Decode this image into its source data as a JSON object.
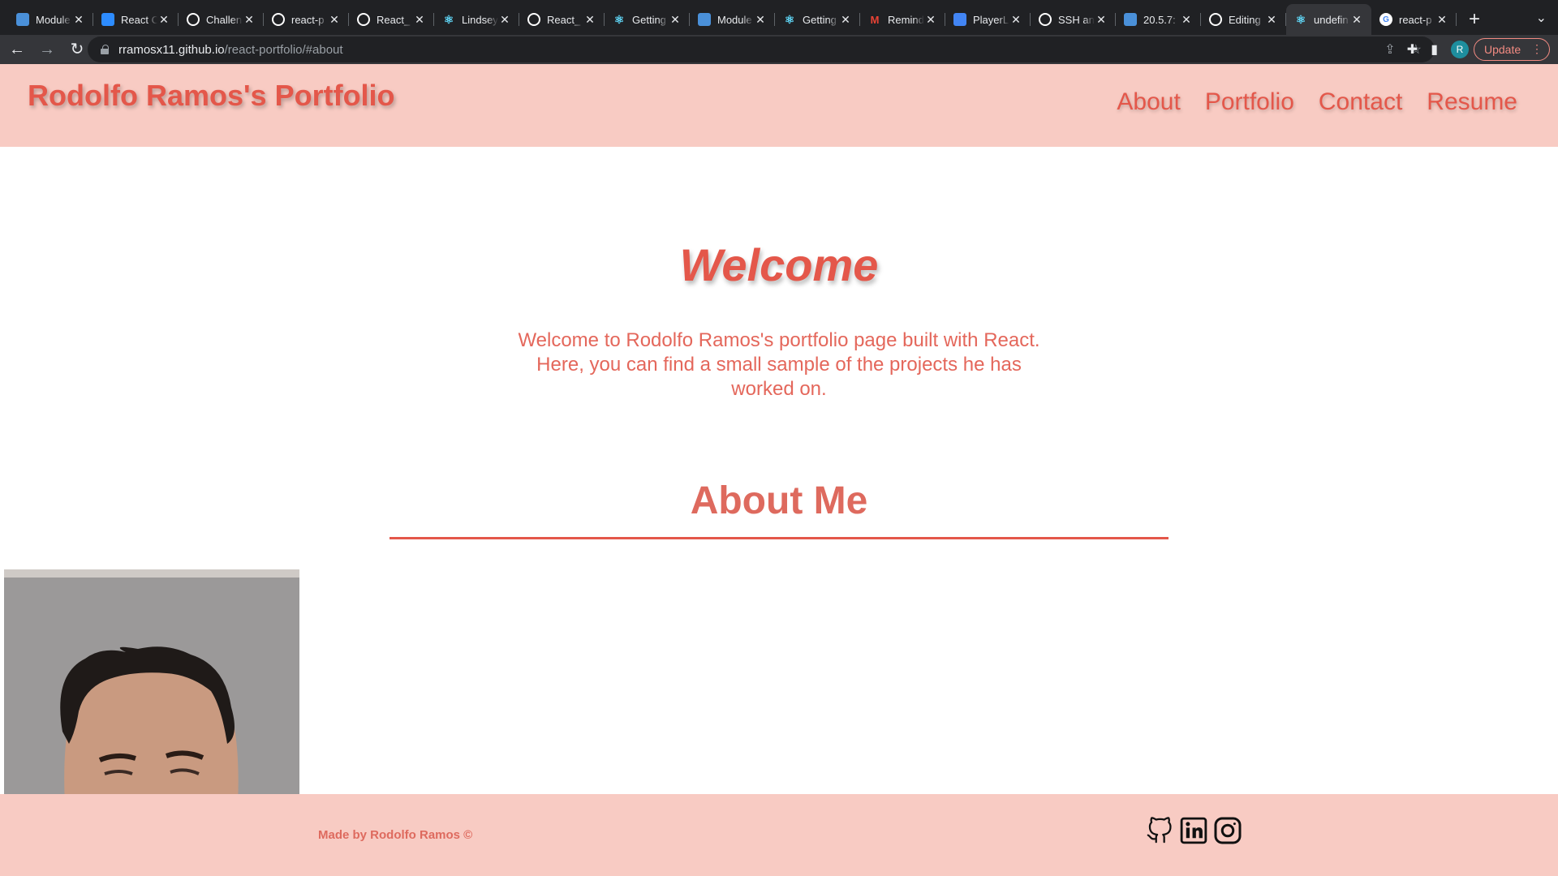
{
  "browser": {
    "tabs": [
      {
        "title": "Module",
        "favicon": "doc-icon",
        "color": "#4a90d9"
      },
      {
        "title": "React C",
        "favicon": "zoom-icon",
        "color": "#2d8cff"
      },
      {
        "title": "Challen",
        "favicon": "github-icon",
        "color": "#ffffff"
      },
      {
        "title": "react-p",
        "favicon": "github-icon",
        "color": "#ffffff"
      },
      {
        "title": "React_",
        "favicon": "github-icon",
        "color": "#ffffff"
      },
      {
        "title": "Lindsey",
        "favicon": "react-icon",
        "color": "#61dafb"
      },
      {
        "title": "React_",
        "favicon": "github-icon",
        "color": "#ffffff"
      },
      {
        "title": "Getting",
        "favicon": "react-icon",
        "color": "#61dafb"
      },
      {
        "title": "Module",
        "favicon": "doc-icon",
        "color": "#4a90d9"
      },
      {
        "title": "Getting",
        "favicon": "react-icon",
        "color": "#61dafb"
      },
      {
        "title": "Remind",
        "favicon": "gmail-icon",
        "color": "#ea4335"
      },
      {
        "title": "PlayerL",
        "favicon": "google-docs-icon",
        "color": "#4285f4"
      },
      {
        "title": "SSH an",
        "favicon": "github-icon",
        "color": "#ffffff"
      },
      {
        "title": "20.5.7:",
        "favicon": "doc-icon",
        "color": "#4a90d9"
      },
      {
        "title": "Editing",
        "favicon": "github-icon",
        "color": "#ffffff"
      },
      {
        "title": "undefin",
        "favicon": "react-icon",
        "color": "#61dafb",
        "active": true
      },
      {
        "title": "react-p",
        "favicon": "google-icon",
        "color": "#4285f4"
      }
    ],
    "url_host": "rramosx11.github.io",
    "url_path": "/react-portfolio/#about",
    "profile_initial": "R",
    "update_label": "Update"
  },
  "site": {
    "brand": "Rodolfo Ramos's Portfolio",
    "nav": [
      "About",
      "Portfolio",
      "Contact",
      "Resume"
    ],
    "welcome_title": "Welcome",
    "welcome_text": "Welcome to Rodolfo Ramos's portfolio page built with React. Here, you can find a small sample of the projects he has worked on.",
    "about_title": "About Me",
    "footer_text": "Made by Rodolfo Ramos ©",
    "social": [
      "github-icon",
      "linkedin-icon",
      "instagram-icon"
    ]
  },
  "colors": {
    "header_bg": "#f8cbc3",
    "accent": "#e4574a",
    "chrome_bg": "#202124"
  }
}
